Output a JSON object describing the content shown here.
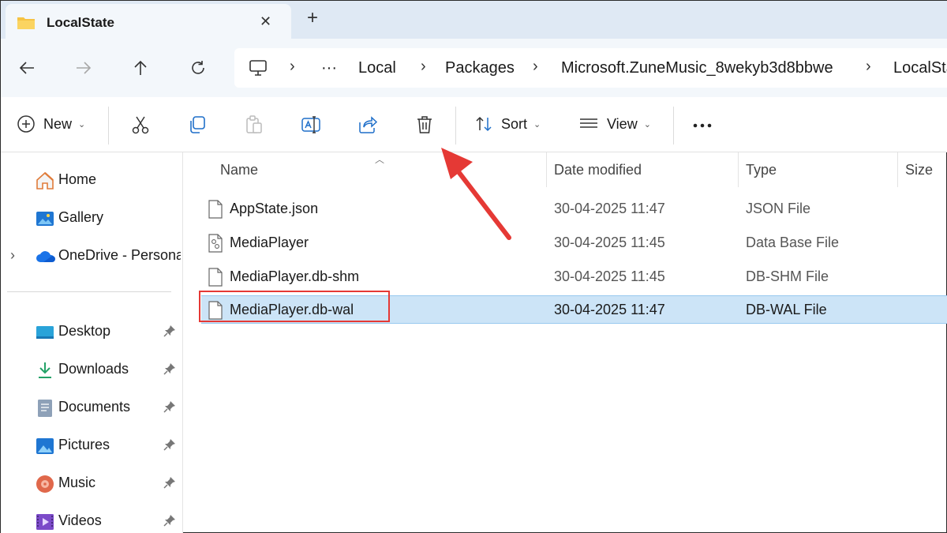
{
  "window": {
    "tab_title": "LocalState",
    "tab_close": "✕",
    "new_tab": "+"
  },
  "address_bar": {
    "overflow": "···",
    "crumbs": [
      "Local",
      "Packages",
      "Microsoft.ZuneMusic_8wekyb3d8bbwe",
      "LocalState"
    ]
  },
  "command_bar": {
    "new_label": "New",
    "sort_label": "Sort",
    "view_label": "View"
  },
  "sidebar": {
    "items": [
      {
        "label": "Home",
        "icon": "home-icon"
      },
      {
        "label": "Gallery",
        "icon": "gallery-icon"
      },
      {
        "label": "OneDrive - Personal",
        "icon": "onedrive-icon"
      },
      {
        "label": "Desktop",
        "icon": "desktop-icon"
      },
      {
        "label": "Downloads",
        "icon": "downloads-icon"
      },
      {
        "label": "Documents",
        "icon": "documents-icon"
      },
      {
        "label": "Pictures",
        "icon": "pictures-icon"
      },
      {
        "label": "Music",
        "icon": "music-icon"
      },
      {
        "label": "Videos",
        "icon": "videos-icon"
      }
    ]
  },
  "file_list": {
    "columns": [
      "Name",
      "Date modified",
      "Type",
      "Size"
    ],
    "rows": [
      {
        "name": "AppState.json",
        "date": "30-04-2025 11:47",
        "type": "JSON File",
        "icon": "document-icon"
      },
      {
        "name": "MediaPlayer",
        "date": "30-04-2025 11:45",
        "type": "Data Base File",
        "icon": "settings-file-icon"
      },
      {
        "name": "MediaPlayer.db-shm",
        "date": "30-04-2025 11:45",
        "type": "DB-SHM File",
        "icon": "document-icon"
      },
      {
        "name": "MediaPlayer.db-wal",
        "date": "30-04-2025 11:47",
        "type": "DB-WAL File",
        "icon": "document-icon",
        "selected": true
      }
    ]
  },
  "colors": {
    "selection": "#cce4f7",
    "annotation": "#e53935",
    "tabbar": "#dfe9f4"
  }
}
